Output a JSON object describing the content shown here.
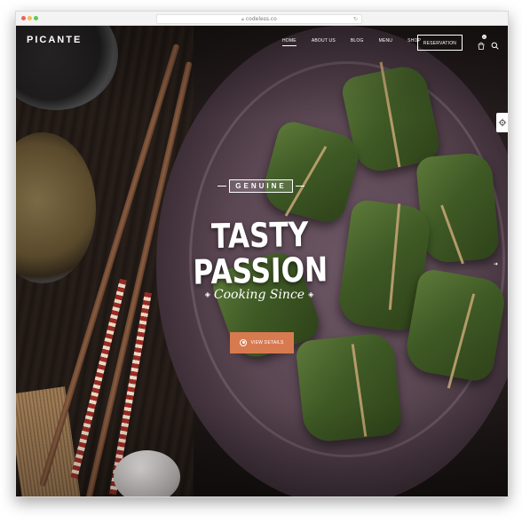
{
  "browser": {
    "url": "codeless.co",
    "lock_icon": "lock-icon",
    "reload_icon": "reload-icon"
  },
  "site": {
    "logo": "PICANTE"
  },
  "nav": {
    "items": [
      {
        "label": "HOME",
        "active": true
      },
      {
        "label": "ABOUT US",
        "active": false
      },
      {
        "label": "BLOG",
        "active": false
      },
      {
        "label": "MENU",
        "active": false
      },
      {
        "label": "SHOP",
        "active": false
      }
    ],
    "reservation_label": "RESERVATION",
    "cart_count": "0",
    "cart_icon": "cart-icon",
    "search_icon": "search-icon"
  },
  "hero": {
    "badge": "GENUINE",
    "headline": "TASTY PASSION",
    "subheadline": "Cooking Since",
    "cta_label": "VIEW DETAILS",
    "cta_color": "#d87a4f",
    "slides": 2,
    "active_slide": 1
  },
  "side_panel": {
    "icon": "gear-icon"
  }
}
